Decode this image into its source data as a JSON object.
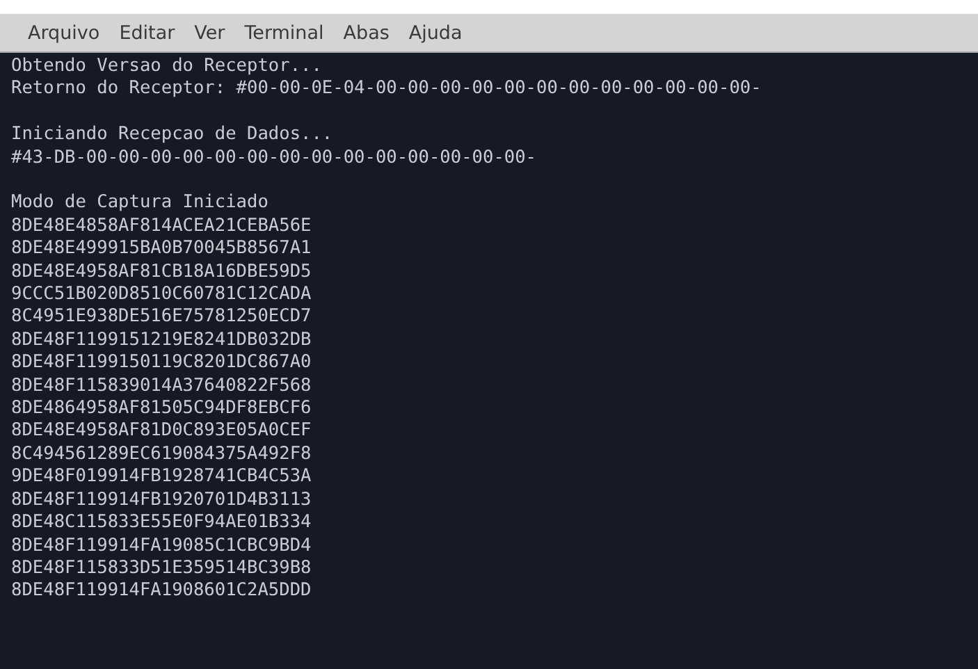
{
  "menu": [
    "Arquivo",
    "Editar",
    "Ver",
    "Terminal",
    "Abas",
    "Ajuda"
  ],
  "terminal": {
    "blocks": [
      [
        "Obtendo Versao do Receptor...",
        "Retorno do Receptor: #00-00-0E-04-00-00-00-00-00-00-00-00-00-00-00-00-"
      ],
      [
        "Iniciando Recepcao de Dados...",
        "#43-DB-00-00-00-00-00-00-00-00-00-00-00-00-00-00-"
      ],
      [
        "Modo de Captura Iniciado",
        "8DE48E4858AF814ACEA21CEBA56E",
        "8DE48E499915BA0B70045B8567A1",
        "8DE48E4958AF81CB18A16DBE59D5",
        "9CCC51B020D8510C60781C12CADA",
        "8C4951E938DE516E75781250ECD7",
        "8DE48F1199151219E8241DB032DB",
        "8DE48F1199150119C8201DC867A0",
        "8DE48F115839014A37640822F568",
        "8DE4864958AF81505C94DF8EBCF6",
        "8DE48E4958AF81D0C893E05A0CEF",
        "8C494561289EC619084375A492F8",
        "9DE48F019914FB1928741CB4C53A",
        "8DE48F119914FB1920701D4B3113",
        "8DE48C115833E55E0F94AE01B334",
        "8DE48F119914FA19085C1CBC9BD4",
        "8DE48F115833D51E359514BC39B8",
        "8DE48F119914FA1908601C2A5DDD"
      ]
    ]
  }
}
